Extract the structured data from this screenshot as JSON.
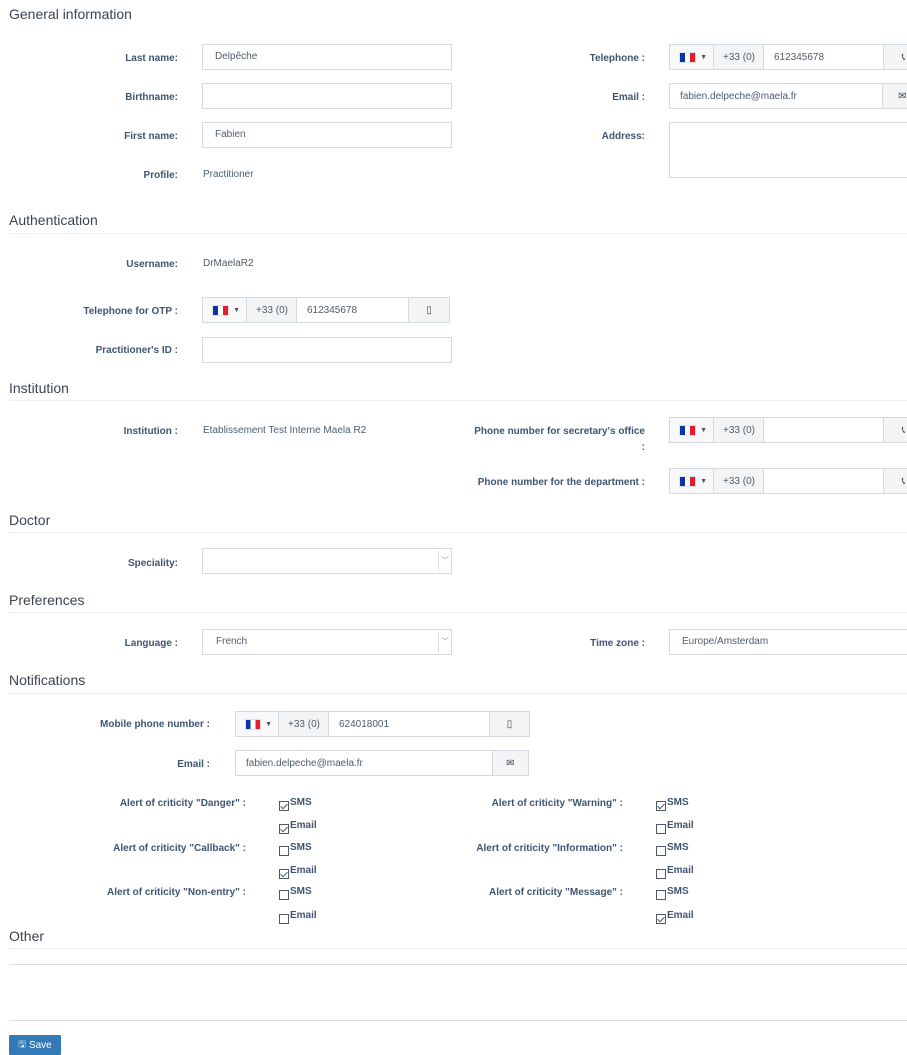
{
  "sections": {
    "general": "General information",
    "auth": "Authentication",
    "institution": "Institution",
    "doctor": "Doctor",
    "preferences": "Preferences",
    "notifications": "Notifications",
    "other": "Other"
  },
  "general": {
    "last_name_label": "Last name:",
    "last_name": "Delpêche",
    "birthname_label": "Birthname:",
    "birthname": "",
    "first_name_label": "First name:",
    "first_name": "Fabien",
    "profile_label": "Profile:",
    "profile": "Practitioner",
    "telephone_label": "Telephone :",
    "telephone_prefix": "+33 (0)",
    "telephone_number": "612345678",
    "email_label": "Email :",
    "email": "fabien.delpeche@maela.fr",
    "address_label": "Address:",
    "address": ""
  },
  "auth": {
    "username_label": "Username:",
    "username": "DrMaelaR2",
    "otp_label": "Telephone for OTP :",
    "otp_prefix": "+33 (0)",
    "otp_number": "612345678",
    "practitioner_id_label": "Practitioner's ID :",
    "practitioner_id": ""
  },
  "institution": {
    "institution_label": "Institution :",
    "institution": "Etablissement Test Interne Maela R2",
    "secretary_label_1": "Phone number for secretary's office",
    "secretary_label_2": ":",
    "secretary_prefix": "+33 (0)",
    "secretary_number": "",
    "department_label": "Phone number for the department :",
    "department_prefix": "+33 (0)",
    "department_number": ""
  },
  "doctor": {
    "speciality_label": "Speciality:",
    "speciality": ""
  },
  "preferences": {
    "language_label": "Language :",
    "language": "French",
    "timezone_label": "Time zone :",
    "timezone": "Europe/Amsterdam"
  },
  "notifications": {
    "mobile_label": "Mobile phone number :",
    "mobile_prefix": "+33 (0)",
    "mobile_number": "624018001",
    "email_label": "Email :",
    "email": "fabien.delpeche@maela.fr",
    "sms_text": "SMS",
    "email_text": "Email",
    "alerts": {
      "danger": {
        "label": "Alert of criticity \"Danger\" :",
        "sms": true,
        "email": true
      },
      "callback": {
        "label": "Alert of criticity \"Callback\" :",
        "sms": false,
        "email": true
      },
      "nonentry": {
        "label": "Alert of criticity \"Non-entry\" :",
        "sms": false,
        "email": false
      },
      "warning": {
        "label": "Alert of criticity \"Warning\" :",
        "sms": true,
        "email": false
      },
      "information": {
        "label": "Alert of criticity \"Information\" :",
        "sms": false,
        "email": false
      },
      "message": {
        "label": "Alert of criticity \"Message\" :",
        "sms": false,
        "email": true
      }
    }
  },
  "icons": {
    "phone": "phone-icon",
    "envelope": "envelope-icon",
    "mobile": "mobile-icon",
    "flag": "france-flag-icon",
    "caret": "caret-down-icon",
    "chevron": "chevron-down-icon",
    "save": "floppy-disk-icon"
  },
  "colors": {
    "save_button": "#337ab7",
    "label": "#3f5571",
    "section_title": "#3a4452"
  },
  "actions": {
    "save_label": "Save"
  }
}
